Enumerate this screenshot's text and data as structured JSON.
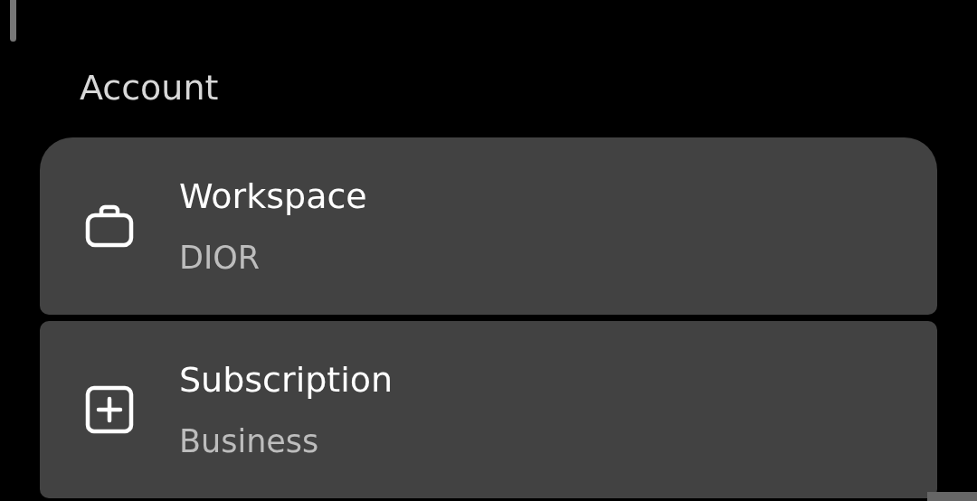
{
  "section": {
    "title": "Account"
  },
  "items": [
    {
      "kind": "briefcase",
      "title": "Workspace",
      "subtitle": "DIOR"
    },
    {
      "kind": "plus-square",
      "title": "Subscription",
      "subtitle": "Business"
    }
  ]
}
